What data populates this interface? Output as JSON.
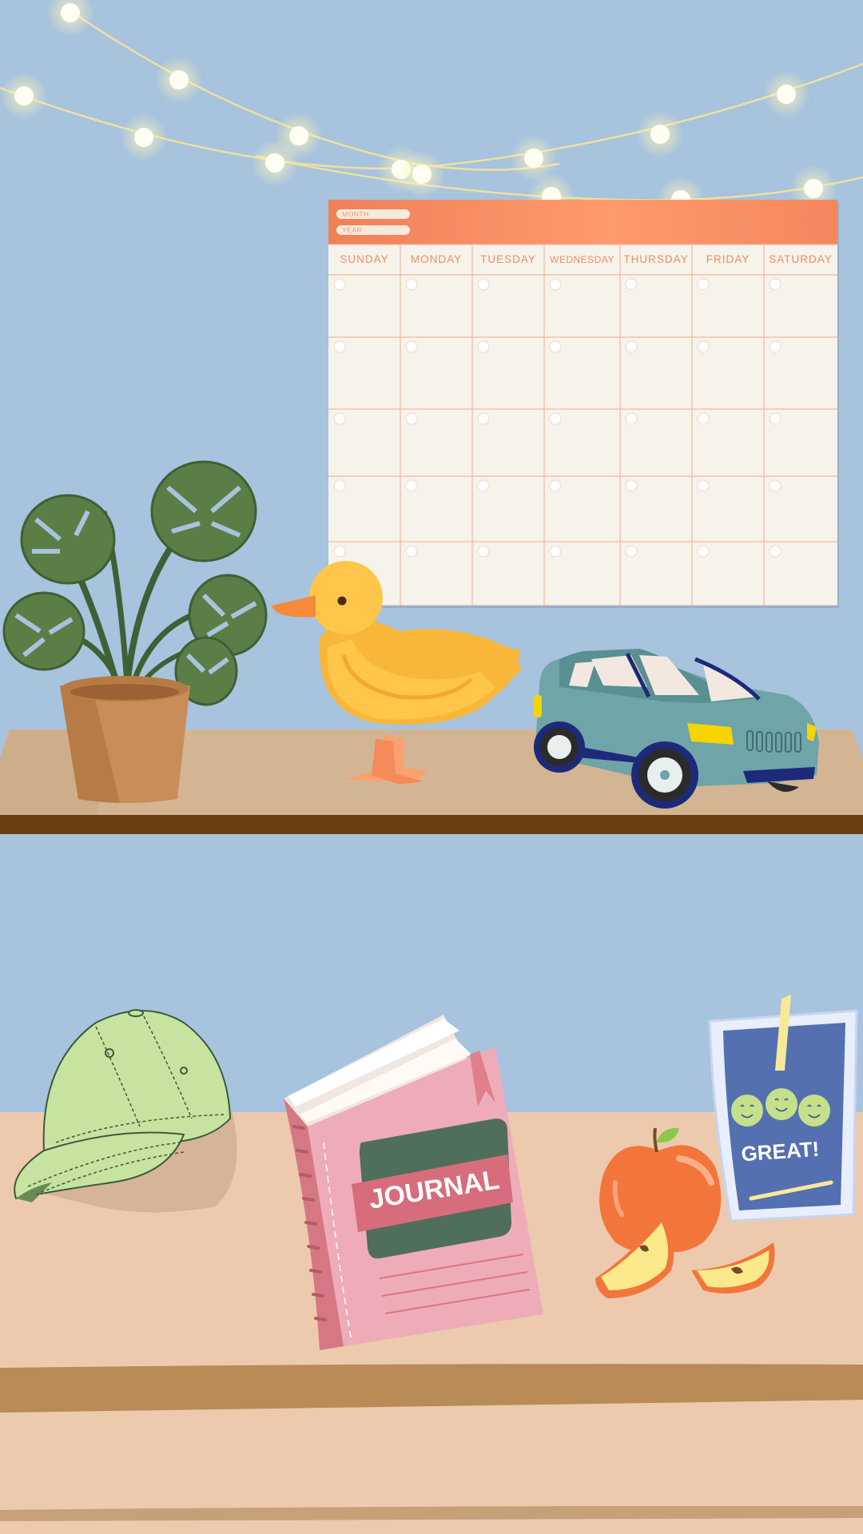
{
  "calendar": {
    "month_label": "MONTH",
    "year_label": "YEAR",
    "days": [
      "SUNDAY",
      "MONDAY",
      "TUESDAY",
      "WEDNESDAY",
      "THURSDAY",
      "FRIDAY",
      "SATURDAY"
    ]
  },
  "journal": {
    "title": "JOURNAL"
  },
  "juice_pouch": {
    "text": "GREAT!"
  },
  "colors": {
    "wall": "#a7c3dd",
    "shelf": "#d3b594",
    "shelf_edge": "#6b3e12",
    "calendar_header": "#f6865d",
    "table": "#edcaae"
  },
  "icons": [
    "string-lights-icon",
    "calendar-icon",
    "monstera-plant-icon",
    "rubber-duck-icon",
    "toy-car-icon",
    "baseball-cap-icon",
    "journal-book-icon",
    "apple-icon",
    "juice-pouch-icon"
  ]
}
